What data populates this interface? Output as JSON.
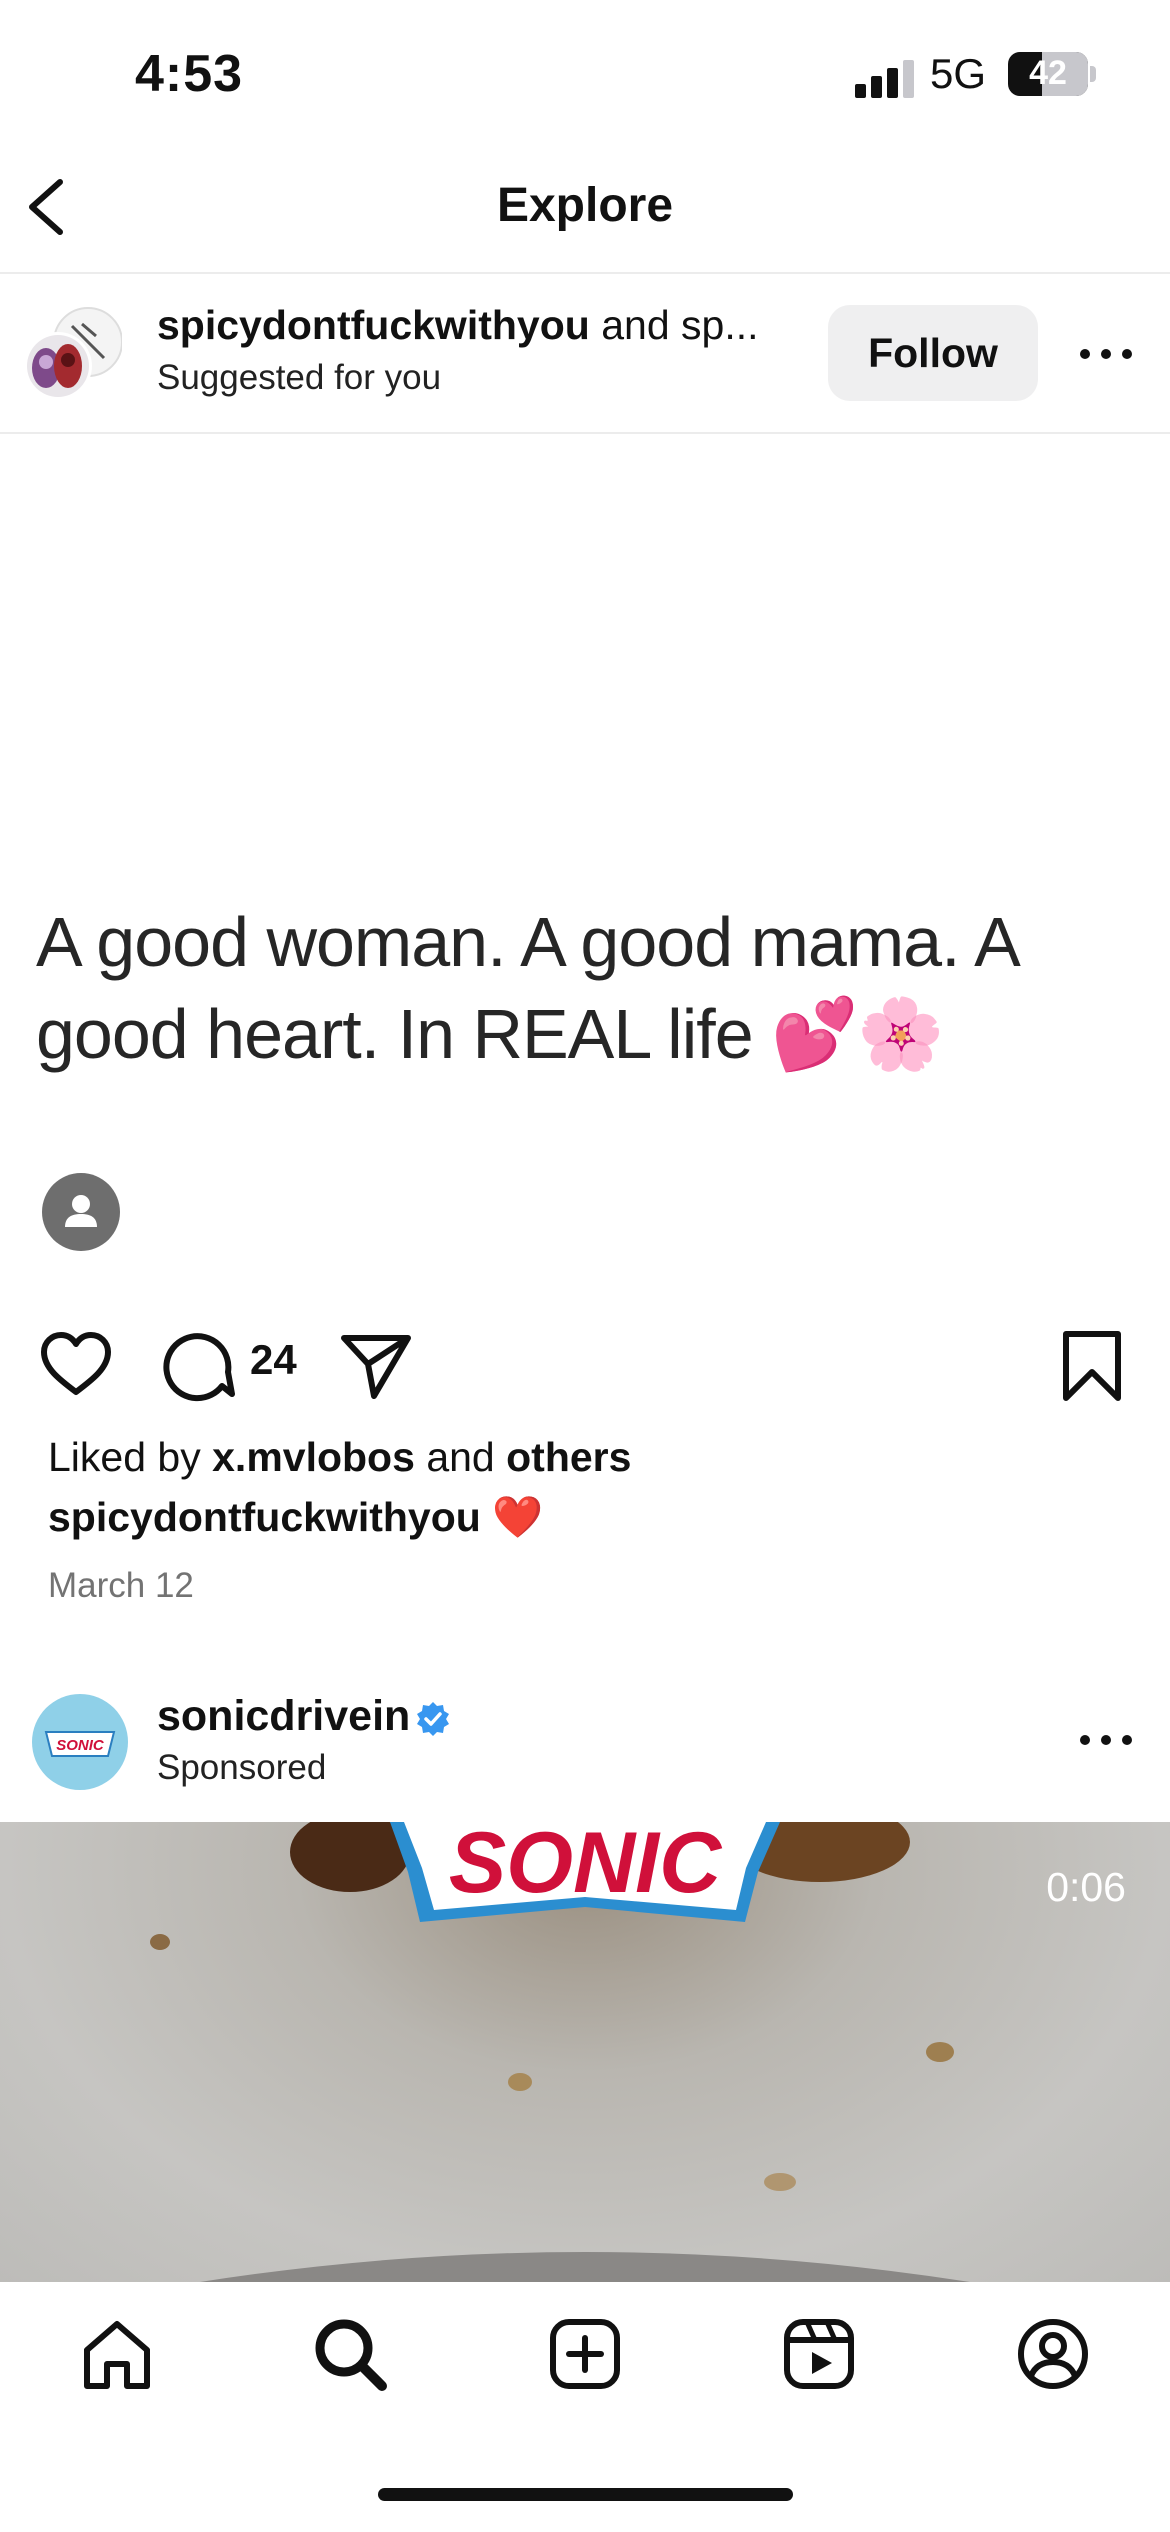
{
  "status_bar": {
    "time": "4:53",
    "network": "5G",
    "battery": "42",
    "battery_level": 0.42
  },
  "nav": {
    "title": "Explore",
    "back_icon": "chevron-left-icon"
  },
  "post": {
    "username": "spicydontfuckwithyou",
    "username_suffix": "and sp...",
    "subtext": "Suggested for you",
    "follow_label": "Follow",
    "quote_text": "A good woman. A good mama. A good heart. In REAL life",
    "quote_emoji": "💕🌸",
    "comment_count": "24",
    "likes_prefix": "Liked by",
    "likes_user": "x.mvlobos",
    "likes_and": "and",
    "likes_others": "others",
    "caption_user": "spicydontfuckwithyou",
    "caption_emoji": "❤️",
    "date": "March 12"
  },
  "sponsored": {
    "username": "sonicdrivein",
    "subtext": "Sponsored",
    "logo_text": "SONIC",
    "avatar_text": "SONIC",
    "duration": "0:06",
    "brand_color": "#d0103a"
  },
  "tabbar": {
    "items": [
      "home-icon",
      "search-icon",
      "create-icon",
      "reels-icon",
      "profile-icon"
    ]
  }
}
